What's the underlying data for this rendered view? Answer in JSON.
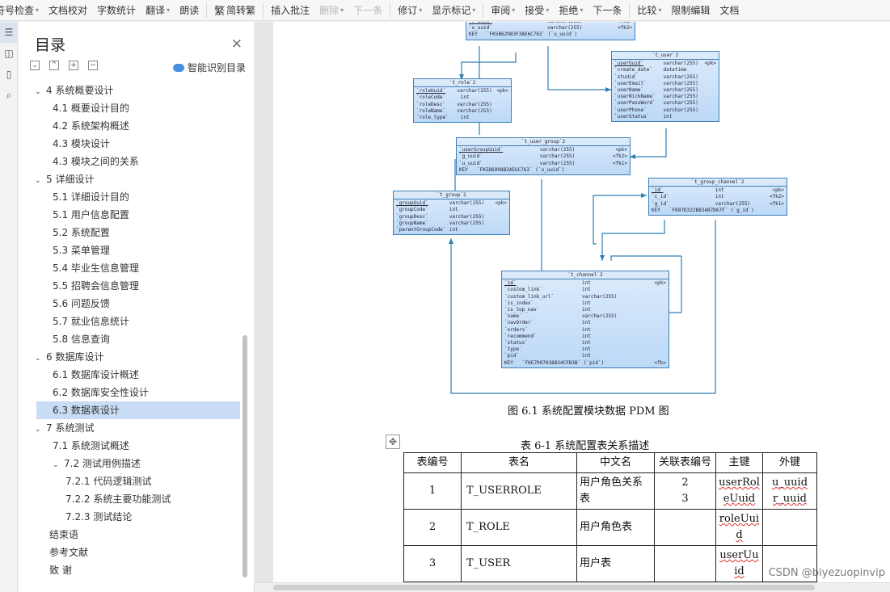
{
  "toolbar": {
    "items": [
      {
        "label": "符号检查",
        "caret": true
      },
      {
        "label": "文档校对"
      },
      {
        "label": "字数统计"
      },
      {
        "label": "翻译",
        "caret": true
      },
      {
        "label": "朗读"
      },
      {
        "label": "简转繁",
        "icon": "繁"
      },
      {
        "label": "插入批注"
      },
      {
        "label": "删除",
        "caret": true,
        "disabled": true
      },
      {
        "label": "下一条",
        "disabled": true
      },
      {
        "label": "修订",
        "caret": true
      },
      {
        "label": "显示标记",
        "caret": true
      },
      {
        "label": "审阅",
        "caret": true
      },
      {
        "label": "接受",
        "caret": true
      },
      {
        "label": "拒绝",
        "caret": true
      },
      {
        "label": "下一条"
      },
      {
        "label": "比较",
        "caret": true
      },
      {
        "label": "限制编辑"
      },
      {
        "label": "文档"
      }
    ]
  },
  "toc": {
    "title": "目录",
    "smart_label": "智能识别目录",
    "items": [
      {
        "label": "4   系统概要设计",
        "level": 1,
        "expanded": true
      },
      {
        "label": "4.1  概要设计目的",
        "level": 2
      },
      {
        "label": "4.2  系统架构概述",
        "level": 2
      },
      {
        "label": "4.3  模块设计",
        "level": 2
      },
      {
        "label": "4.3  模块之间的关系",
        "level": 2
      },
      {
        "label": "5  详细设计",
        "level": 1,
        "expanded": true
      },
      {
        "label": "5.1  详细设计目的",
        "level": 2
      },
      {
        "label": "5.1  用户信息配置",
        "level": 2
      },
      {
        "label": "5.2  系统配置",
        "level": 2
      },
      {
        "label": "5.3  菜单管理",
        "level": 2
      },
      {
        "label": "5.4  毕业生信息管理",
        "level": 2
      },
      {
        "label": "5.5  招聘会信息管理",
        "level": 2
      },
      {
        "label": "5.6  问题反馈",
        "level": 2
      },
      {
        "label": "5.7  就业信息统计",
        "level": 2
      },
      {
        "label": "5.8  信息查询",
        "level": 2
      },
      {
        "label": "6  数据库设计",
        "level": 1,
        "expanded": true
      },
      {
        "label": "6.1  数据库设计概述",
        "level": 2
      },
      {
        "label": "6.2  数据库安全性设计",
        "level": 2
      },
      {
        "label": "6.3 数据表设计",
        "level": 2,
        "selected": true
      },
      {
        "label": "7  系统测试",
        "level": 1,
        "expanded": true
      },
      {
        "label": "7.1  系统测试概述",
        "level": 2
      },
      {
        "label": "7.2  测试用例描述",
        "level": 2,
        "expanded": true
      },
      {
        "label": "7.2.1  代码逻辑测试",
        "level": 3
      },
      {
        "label": "7.2.2  系统主要功能测试",
        "level": 3
      },
      {
        "label": "7.2.3  测试结论",
        "level": 3
      },
      {
        "label": "结束语",
        "level": 0
      },
      {
        "label": "参考文献",
        "level": 0
      },
      {
        "label": "致    谢",
        "level": 0
      }
    ]
  },
  "diagram": {
    "tables": [
      {
        "name": "t_user_role",
        "title": "",
        "rows": [
          [
            "`r_uuid`",
            "varchar(255)",
            "<fk1>"
          ],
          [
            "`u_uuid`",
            "varchar(255)",
            "<fk2>"
          ],
          [
            "KEY",
            "`FK5B62983F3AE6C763` (`u_uuid`)",
            ""
          ]
        ]
      },
      {
        "name": "t_user",
        "title": "`t_user`2",
        "rows": [
          [
            "`userUuid`",
            "varchar(255)",
            "<pk>"
          ],
          [
            "`create_date`",
            "datetime",
            ""
          ],
          [
            "`stuUid`",
            "varchar(255)",
            ""
          ],
          [
            "`userEmail`",
            "varchar(255)",
            ""
          ],
          [
            "`userName`",
            "varchar(255)",
            ""
          ],
          [
            "`userNickName`",
            "varchar(255)",
            ""
          ],
          [
            "`userPassWord`",
            "varchar(255)",
            ""
          ],
          [
            "`userPhone`",
            "varchar(255)",
            ""
          ],
          [
            "`userStatus`",
            "int",
            ""
          ]
        ]
      },
      {
        "name": "t_role",
        "title": "`t_role`2",
        "rows": [
          [
            "`roleUuid`",
            "varchar(255)",
            "<pk>"
          ],
          [
            "`roleCode`",
            "int",
            ""
          ],
          [
            "`roleDesc`",
            "varchar(255)",
            ""
          ],
          [
            "`roleName`",
            "varchar(255)",
            ""
          ],
          [
            "`role_type`",
            "int",
            ""
          ]
        ]
      },
      {
        "name": "t_user_group",
        "title": "`t_user_group`2",
        "rows": [
          [
            "`userGroupUuid`",
            "varchar(255)",
            "<pk>"
          ],
          [
            "`g_uuid`",
            "varchar(255)",
            "<fk2>"
          ],
          [
            "`u_uuid`",
            "varchar(255)",
            "<fk1>"
          ],
          [
            "KEY",
            "`FK5D6998B3AE6C763` (`u_uuid`)",
            ""
          ]
        ]
      },
      {
        "name": "t_group_channel",
        "title": "`t_group_channel`2",
        "rows": [
          [
            "`id`",
            "int",
            "<pk>"
          ],
          [
            "`c_id`",
            "int",
            "<fk2>"
          ],
          [
            "`g_id`",
            "varchar(255)",
            "<fk1>"
          ],
          [
            "KEY",
            "`FK87D322B834B7D67F` (`g_id`)",
            ""
          ]
        ]
      },
      {
        "name": "t_group",
        "title": "`t_group`2",
        "rows": [
          [
            "`groupUuid`",
            "varchar(255)",
            "<pk>"
          ],
          [
            "`groupCode`",
            "int",
            ""
          ],
          [
            "`groupDesc`",
            "varchar(255)",
            ""
          ],
          [
            "`groupName`",
            "varchar(255)",
            ""
          ],
          [
            "`parentGroupCode`",
            "int",
            ""
          ]
        ]
      },
      {
        "name": "t_channel",
        "title": "`t_channel`2",
        "rows": [
          [
            "`id`",
            "int",
            "<pk>"
          ],
          [
            "`custom_link`",
            "int",
            ""
          ],
          [
            "`custom_link_url`",
            "varchar(255)",
            ""
          ],
          [
            "`is_index`",
            "int",
            ""
          ],
          [
            "`is_top_nav`",
            "int",
            ""
          ],
          [
            "`name`",
            "varchar(255)",
            ""
          ],
          [
            "`navOrder`",
            "int",
            ""
          ],
          [
            "`orders`",
            "int",
            ""
          ],
          [
            "`recommend`",
            "int",
            ""
          ],
          [
            "`status`",
            "int",
            ""
          ],
          [
            "`type`",
            "int",
            ""
          ],
          [
            "`pid`",
            "int",
            ""
          ],
          [
            "KEY",
            "`FKE7007038834CFB3B` (`pid`)",
            "<fk>"
          ]
        ]
      }
    ]
  },
  "figure_caption": "图  6.1  系统配置模块数据 PDM 图",
  "table_caption": "表  6-1  系统配置表关系描述",
  "relation_table": {
    "headers": [
      "表编号",
      "表名",
      "中文名",
      "关联表编号",
      "主键",
      "外键"
    ],
    "rows": [
      [
        "1",
        "T_USERROLE",
        "用户角色关系表",
        "2\n3",
        "userRoleUuid",
        "u_uuid\nr_uuid"
      ],
      [
        "2",
        "T_ROLE",
        "用户角色表",
        "",
        "roleUuid",
        ""
      ],
      [
        "3",
        "T_USER",
        "用户表",
        "",
        "userUuid",
        ""
      ]
    ]
  },
  "watermark": "CSDN @biyezuopinvip"
}
